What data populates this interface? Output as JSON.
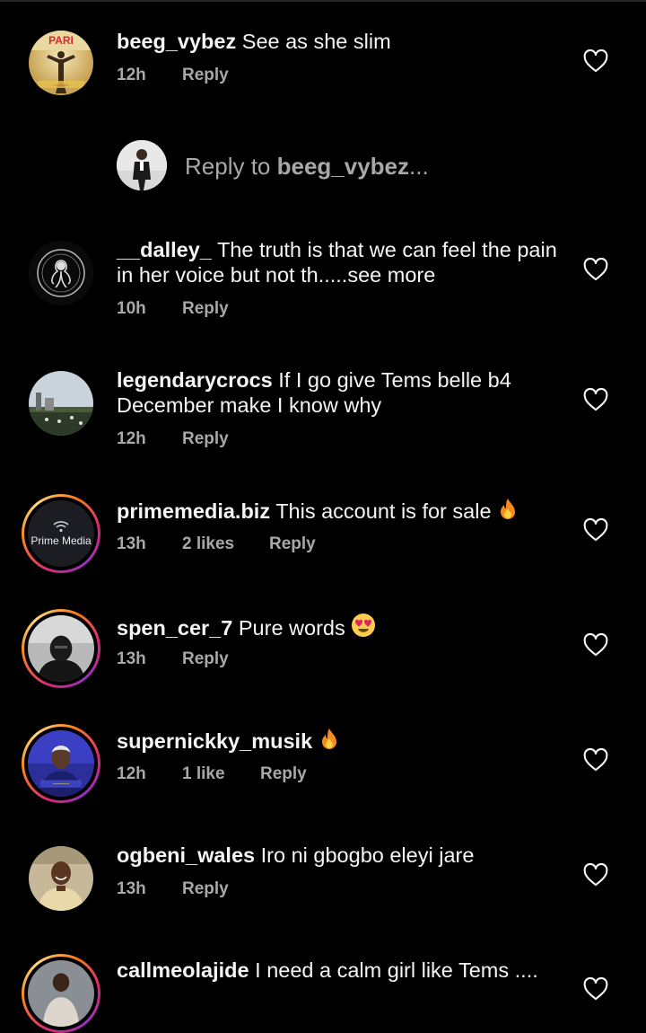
{
  "reply_box": {
    "prefix": "Reply to ",
    "target": "beeg_vybez",
    "suffix": "..."
  },
  "reply_label": "Reply",
  "comments": [
    {
      "username": "beeg_vybez",
      "text": "See as she slim",
      "time": "12h",
      "likes": ""
    },
    {
      "username": "__dalley_",
      "text": "The truth is that we can feel the pain in her voice but not th.....see more",
      "time": "10h",
      "likes": ""
    },
    {
      "username": "legendarycrocs",
      "text": "If I go give Tems belle b4 December make I know why",
      "time": "12h",
      "likes": ""
    },
    {
      "username": "primemedia.biz",
      "text": "This account is for sale",
      "time": "13h",
      "likes": "2 likes",
      "avatar_text": "Prime Media"
    },
    {
      "username": "spen_cer_7",
      "text": "Pure words",
      "time": "13h",
      "likes": ""
    },
    {
      "username": "supernickky_musik",
      "text": "",
      "time": "12h",
      "likes": "1 like"
    },
    {
      "username": "ogbeni_wales",
      "text": "Iro ni gbogbo eleyi jare",
      "time": "13h",
      "likes": ""
    },
    {
      "username": "callmeolajide",
      "text": "I need a calm girl like Tems ....",
      "time": "",
      "likes": ""
    }
  ],
  "colors": {
    "background": "#000000",
    "text": "#f5f5f5",
    "secondary": "#a8a8a8",
    "story_ring_start": "#d62976",
    "story_ring_mid": "#fa7e1e"
  },
  "icons": {
    "like": "heart-outline-icon",
    "fire": "fire-emoji",
    "heart_eyes": "heart-eyes-emoji"
  }
}
